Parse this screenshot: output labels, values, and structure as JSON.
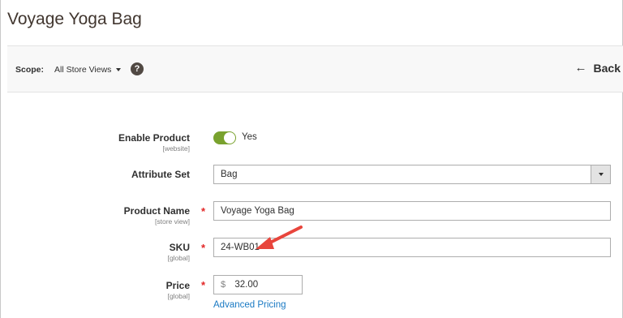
{
  "page": {
    "title": "Voyage Yoga Bag"
  },
  "toolbar": {
    "scope_label": "Scope:",
    "scope_value": "All Store Views",
    "help_glyph": "?",
    "back_label": "Back",
    "back_icon": "arrow-left-icon"
  },
  "form": {
    "enable_product": {
      "label": "Enable Product",
      "scope": "[website]",
      "value_text": "Yes",
      "enabled": true,
      "color": "#79a22e"
    },
    "attribute_set": {
      "label": "Attribute Set",
      "value": "Bag"
    },
    "product_name": {
      "label": "Product Name",
      "scope": "[store view]",
      "value": "Voyage Yoga Bag",
      "required": "*"
    },
    "sku": {
      "label": "SKU",
      "scope": "[global]",
      "value": "24-WB01",
      "required": "*"
    },
    "price": {
      "label": "Price",
      "scope": "[global]",
      "currency": "$",
      "value": "32.00",
      "required": "*",
      "advanced_pricing_link": "Advanced Pricing"
    }
  },
  "colors": {
    "accent": "#79a22e",
    "link": "#1979c3",
    "required": "#e22626",
    "annotation_arrow": "#e8453c"
  }
}
